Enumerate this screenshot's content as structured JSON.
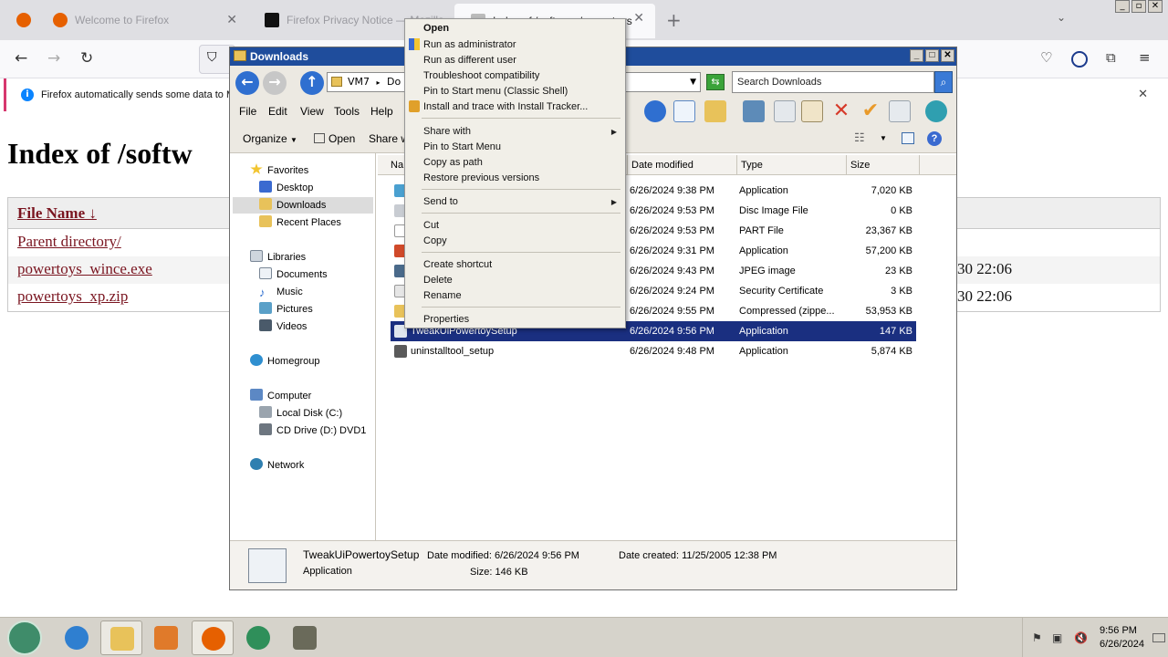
{
  "firefox": {
    "tabs": [
      {
        "label": "Welcome to Firefox"
      },
      {
        "label": "Firefox Privacy Notice — Mozilla"
      },
      {
        "label": "Index of /software/powertoys"
      }
    ],
    "notification": "Firefox automatically sends some data to M",
    "page": {
      "heading": "Index of /softw",
      "column_header": "File Name  ↓",
      "rows": [
        {
          "name": "Parent directory/",
          "date": ""
        },
        {
          "name": "powertoys_wince.exe",
          "date": "30 22:06"
        },
        {
          "name": "powertoys_xp.zip",
          "date": "30 22:06"
        }
      ]
    }
  },
  "explorer": {
    "title": "Downloads",
    "breadcrumb": [
      "VM7",
      "Do"
    ],
    "search_placeholder": "Search Downloads",
    "menu": [
      "File",
      "Edit",
      "View",
      "Tools",
      "Help"
    ],
    "commands": {
      "organize": "Organize",
      "open": "Open",
      "share": "Share w"
    },
    "nav": {
      "favorites": "Favorites",
      "desktop": "Desktop",
      "downloads": "Downloads",
      "recent": "Recent Places",
      "libraries": "Libraries",
      "documents": "Documents",
      "music": "Music",
      "pictures": "Pictures",
      "videos": "Videos",
      "homegroup": "Homegroup",
      "computer": "Computer",
      "local_disk": "Local Disk (C:)",
      "cd_drive": "CD Drive (D:) DVD1",
      "network": "Network"
    },
    "columns": {
      "name": "Na",
      "date": "Date modified",
      "type": "Type",
      "size": "Size"
    },
    "files": [
      {
        "name": "",
        "date": "6/26/2024 9:38 PM",
        "type": "Application",
        "size": "7,020 KB"
      },
      {
        "name": "",
        "date": "6/26/2024 9:53 PM",
        "type": "Disc Image File",
        "size": "0 KB"
      },
      {
        "name": "",
        "date": "6/26/2024 9:53 PM",
        "type": "PART File",
        "size": "23,367 KB"
      },
      {
        "name": "",
        "date": "6/26/2024 9:31 PM",
        "type": "Application",
        "size": "57,200 KB"
      },
      {
        "name": "",
        "date": "6/26/2024 9:43 PM",
        "type": "JPEG image",
        "size": "23 KB"
      },
      {
        "name": "",
        "date": "6/26/2024 9:24 PM",
        "type": "Security Certificate",
        "size": "3 KB"
      },
      {
        "name": "",
        "date": "6/26/2024 9:55 PM",
        "type": "Compressed (zippe...",
        "size": "53,953 KB"
      },
      {
        "name": "TweakUiPowertoySetup",
        "date": "6/26/2024 9:56 PM",
        "type": "Application",
        "size": "147 KB"
      },
      {
        "name": "uninstalltool_setup",
        "date": "6/26/2024 9:48 PM",
        "type": "Application",
        "size": "5,874 KB"
      }
    ],
    "details": {
      "name": "TweakUiPowertoySetup",
      "kind": "Application",
      "modified": "Date modified: 6/26/2024 9:56 PM",
      "size": "Size:  146 KB",
      "created": "Date created: 11/25/2005 12:38 PM"
    }
  },
  "context_menu": {
    "open": "Open",
    "run_admin": "Run as administrator",
    "run_other": "Run as different user",
    "troubleshoot": "Troubleshoot compatibility",
    "pin_start_classic": "Pin to Start menu (Classic Shell)",
    "install_trace": "Install and trace with Install Tracker...",
    "share_with": "Share with",
    "pin_start": "Pin to Start Menu",
    "copy_path": "Copy as path",
    "restore": "Restore previous versions",
    "send_to": "Send to",
    "cut": "Cut",
    "copy": "Copy",
    "create_shortcut": "Create shortcut",
    "delete": "Delete",
    "rename": "Rename",
    "properties": "Properties"
  },
  "taskbar": {
    "time": "9:56 PM",
    "date": "6/26/2024"
  },
  "colors": {
    "title_blue": "#1f4d9c",
    "selection": "#1a2f80",
    "link": "#7a1520"
  }
}
